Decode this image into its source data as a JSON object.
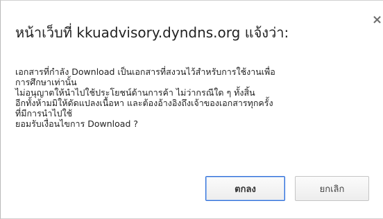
{
  "dialog": {
    "title": "หน้าเว็บที่ kkuadvisory.dyndns.org แจ้งว่า:",
    "close_glyph": "×",
    "close_icon": "close-icon",
    "message_lines": [
      "เอกสารที่กำลัง Download เป็นเอกสารที่สงวนไว้สำหรับการใช้งานเพื่อ",
      "การศึกษาเท่านั้น",
      "ไม่อนุญาตให้นำไปใช้ประโยชน์ด้านการค้า ไม่ว่ากรณีใด ๆ ทั้งสิ้น",
      "อีกทั้งห้ามมิให้ดัดแปลงเนื้อหา และต้องอ้างอิงถึงเจ้าของเอกสารทุกครั้ง",
      "ที่มีการนำไปใช้",
      "ยอมรับเงื่อนไขการ Download ?"
    ],
    "ok_label": "ตกลง",
    "cancel_label": "ยกเลิก",
    "colors": {
      "ok_border": "#2f6ed6",
      "text": "#222222"
    }
  }
}
